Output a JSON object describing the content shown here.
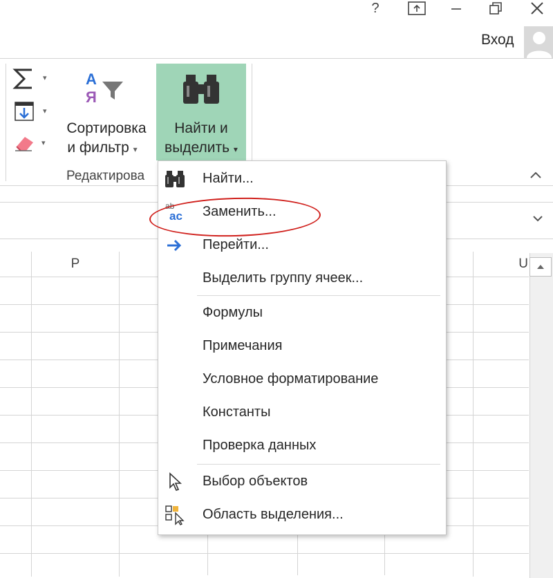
{
  "titlebar": {
    "help_icon": "question-icon",
    "ribbon_display_icon": "ribbon-display-icon",
    "minimize_icon": "minimize-icon",
    "restore_icon": "restore-icon",
    "close_icon": "close-icon"
  },
  "account": {
    "login_label": "Вход"
  },
  "ribbon": {
    "editing_group": {
      "sort_filter_line1": "Сортировка",
      "sort_filter_line2": "и фильтр",
      "find_select_line1": "Найти и",
      "find_select_line2": "выделить",
      "group_label": "Редактирова",
      "dropdown_caret": "▾",
      "sort_letters_top": "А",
      "sort_letters_bottom": "Я"
    }
  },
  "sheet": {
    "column_headers": [
      "P",
      "U"
    ]
  },
  "menu": {
    "items": [
      {
        "label": "Найти...",
        "icon": "binoculars-icon"
      },
      {
        "label": "Заменить...",
        "icon": "replace-icon"
      },
      {
        "label": "Перейти...",
        "icon": "arrow-right-icon"
      },
      {
        "label": "Выделить группу ячеек...",
        "icon": ""
      },
      {
        "label": "Формулы",
        "icon": ""
      },
      {
        "label": "Примечания",
        "icon": ""
      },
      {
        "label": "Условное форматирование",
        "icon": ""
      },
      {
        "label": "Константы",
        "icon": ""
      },
      {
        "label": "Проверка данных",
        "icon": ""
      },
      {
        "label": "Выбор объектов",
        "icon": "pointer-icon"
      },
      {
        "label": "Область выделения...",
        "icon": "selection-pane-icon"
      }
    ],
    "replace_icon_text_top": "ab",
    "replace_icon_text_bottom": "ac"
  },
  "colors": {
    "find_button_bg": "#9fd5b7",
    "highlight_ring": "#d0201c",
    "arrow_blue": "#2b6fd6"
  }
}
